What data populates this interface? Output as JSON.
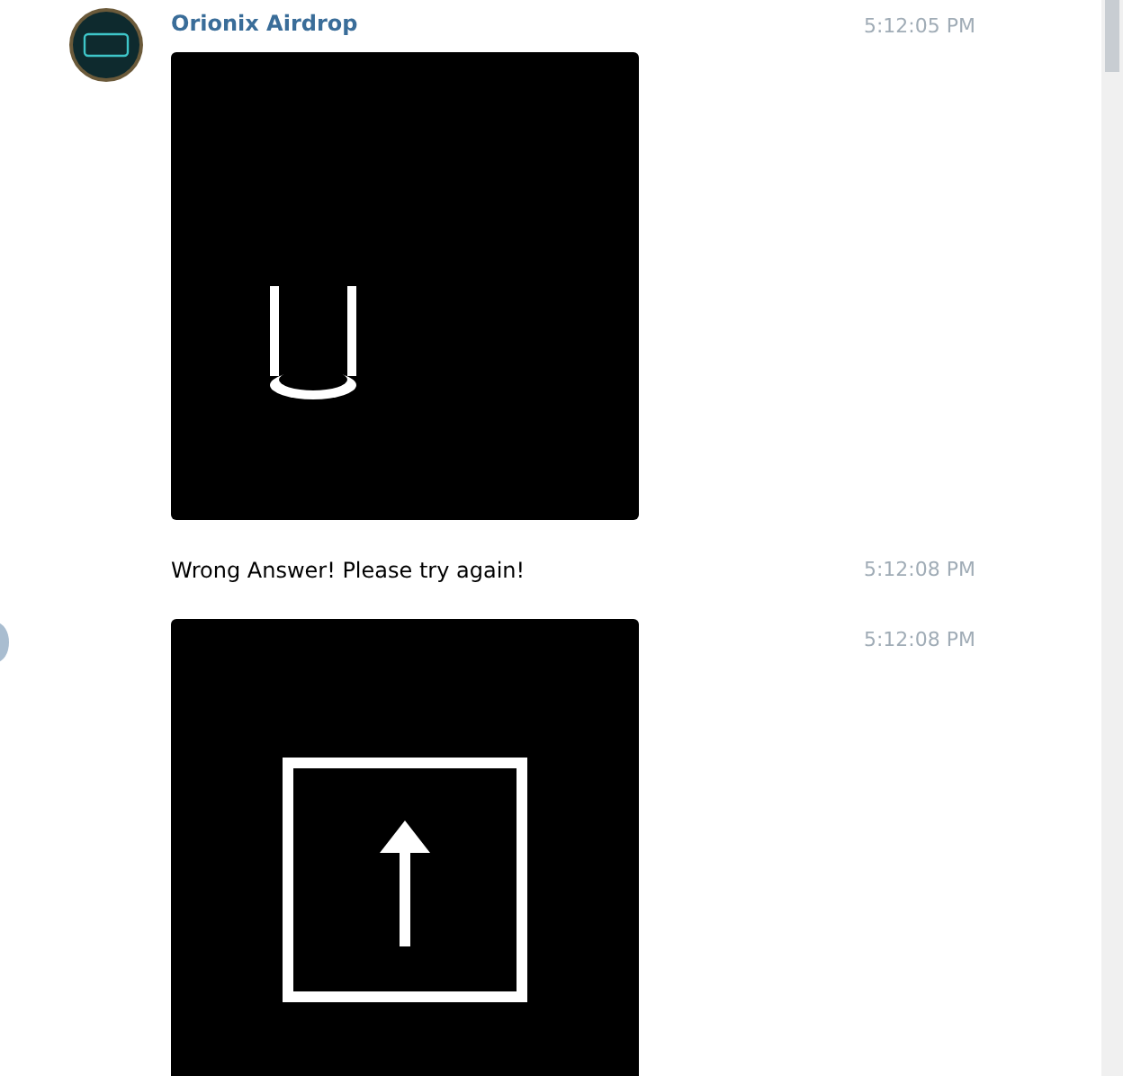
{
  "chat": {
    "sender": "Orionix Airdrop",
    "messages": [
      {
        "time": "5:12:05 PM"
      },
      {
        "kind": "text",
        "text": "Wrong Answer! Please try again!",
        "time": "5:12:08 PM"
      },
      {
        "time": "5:12:08 PM"
      }
    ]
  }
}
